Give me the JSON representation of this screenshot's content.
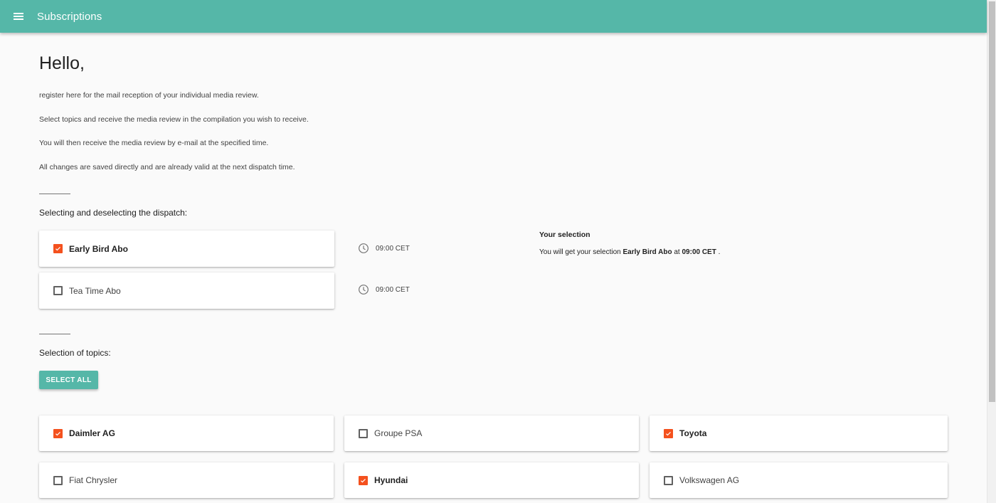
{
  "appbar": {
    "title": "Subscriptions"
  },
  "greeting": "Hello,",
  "intro": [
    "register here for the mail reception of your individual media review.",
    "Select topics and receive the media review in the compilation you wish to receive.",
    "You will then receive the media review by e-mail at the specified time.",
    "All changes are saved directly and are already valid at the next dispatch time."
  ],
  "dispatch": {
    "label": "Selecting and deselecting the dispatch:",
    "items": [
      {
        "label": "Early Bird Abo",
        "checked": true,
        "time": "09:00 CET"
      },
      {
        "label": "Tea Time Abo",
        "checked": false,
        "time": "09:00 CET"
      }
    ]
  },
  "selection": {
    "title": "Your selection",
    "prefix": "You will get your selection",
    "subscription": "Early Bird Abo",
    "at": "at",
    "time": "09:00 CET",
    "suffix": "."
  },
  "topics": {
    "label": "Selection of topics:",
    "select_all": "SELECT ALL",
    "items": [
      {
        "label": "Daimler AG",
        "checked": true
      },
      {
        "label": "Groupe PSA",
        "checked": false
      },
      {
        "label": "Toyota",
        "checked": true
      },
      {
        "label": "Fiat Chrysler",
        "checked": false
      },
      {
        "label": "Hyundai",
        "checked": true
      },
      {
        "label": "Volkswagen AG",
        "checked": false
      }
    ]
  },
  "colors": {
    "primary": "#55b7a8",
    "checked": "#f4511e"
  }
}
